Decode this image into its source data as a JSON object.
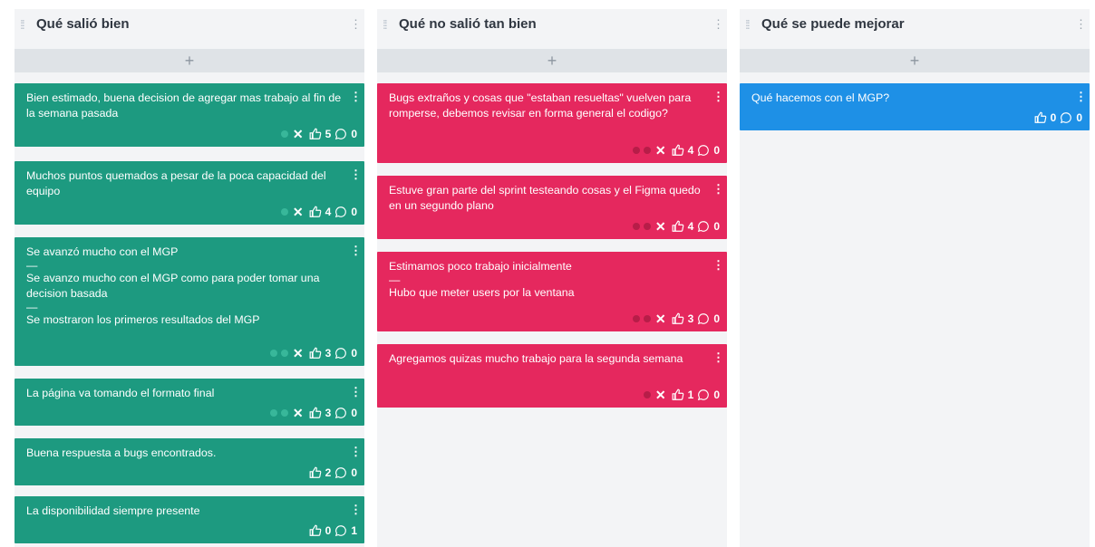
{
  "columns": [
    {
      "title": "Qué salió bien",
      "add_label": "+",
      "cards": [
        {
          "text": [
            "Bien estimado, buena decision de agregar mas trabajo al fin de la semana pasada"
          ],
          "votes": "5",
          "comments": "0",
          "dots": 1,
          "x": true
        },
        {
          "text": [
            "Muchos puntos quemados a pesar de la poca capacidad del equipo"
          ],
          "votes": "4",
          "comments": "0",
          "dots": 1,
          "x": true
        },
        {
          "text": [
            "Se avanzó mucho con el MGP",
            "—",
            "Se avanzo mucho con el MGP como para poder tomar una decision basada",
            "—",
            "Se mostraron los primeros resultados del MGP"
          ],
          "votes": "3",
          "comments": "0",
          "dots": 2,
          "x": true
        },
        {
          "text": [
            "La página va tomando el formato final"
          ],
          "votes": "3",
          "comments": "0",
          "dots": 2,
          "x": true
        },
        {
          "text": [
            "Buena respuesta a bugs encontrados."
          ],
          "votes": "2",
          "comments": "0",
          "dots": 0,
          "x": false
        },
        {
          "text": [
            "La disponibilidad siempre presente"
          ],
          "votes": "0",
          "comments": "1",
          "dots": 0,
          "x": false
        }
      ]
    },
    {
      "title": "Qué no salió tan bien",
      "add_label": "+",
      "cards": [
        {
          "text": [
            "Bugs extraños y cosas que \"estaban resueltas\" vuelven para romperse, debemos revisar en forma general el codigo?"
          ],
          "votes": "4",
          "comments": "0",
          "dots": 2,
          "x": true
        },
        {
          "text": [
            "Estuve gran parte del sprint testeando cosas y el Figma quedo en un segundo plano"
          ],
          "votes": "4",
          "comments": "0",
          "dots": 2,
          "x": true
        },
        {
          "text": [
            "Estimamos poco trabajo inicialmente",
            "—",
            "Hubo que meter users por la ventana"
          ],
          "votes": "3",
          "comments": "0",
          "dots": 2,
          "x": true
        },
        {
          "text": [
            "Agregamos quizas mucho trabajo para la segunda semana"
          ],
          "votes": "1",
          "comments": "0",
          "dots": 1,
          "x": true
        }
      ]
    },
    {
      "title": "Qué se puede mejorar",
      "add_label": "+",
      "cards": [
        {
          "text": [
            "Qué hacemos con el MGP?"
          ],
          "votes": "0",
          "comments": "0",
          "dots": 0,
          "x": false
        }
      ]
    }
  ],
  "icons": {
    "drag": "drag-handle-icon",
    "menu": "kebab-menu-icon",
    "add": "plus-icon",
    "remove": "close-icon",
    "vote": "thumbs-up-icon",
    "comment": "comment-icon"
  },
  "colors": {
    "column_bg": "#f3f4f6",
    "add_bar": "#dfe3e7",
    "green_card": "#1d9a80",
    "pink_card": "#e5285e",
    "blue_card": "#1e90e6"
  }
}
